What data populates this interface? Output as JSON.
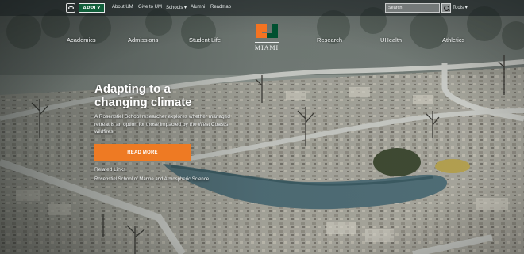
{
  "topbar": {
    "apply_label": "APPLY",
    "links": [
      "About UM",
      "Give to UM",
      "Schools",
      "Alumni",
      "Readmap"
    ],
    "schools_caret": "▾",
    "search_placeholder": "Search",
    "tools_label": "Tools",
    "tools_caret": "▾"
  },
  "nav": {
    "left": [
      "Academics",
      "Admissions",
      "Student Life"
    ],
    "right": [
      "Research",
      "UHealth",
      "Athletics"
    ],
    "logo_text": "MIAMI"
  },
  "hero": {
    "headline_line1": "Adapting to a",
    "headline_line2": "changing climate",
    "teaser": "A Rosenstiel School researcher explores whether managed retreat is an option for those impacted by the West Coast's wildfires.",
    "cta_label": "READ MORE",
    "related_title": "Related Links",
    "related_link": "Rosenstiel School of Marine and Atmospheric Science"
  },
  "colors": {
    "apply_bg": "#115e3a",
    "cta_bg": "#ee7a23",
    "logo_orange": "#f47321",
    "logo_green": "#005030"
  },
  "icons": [
    "eye-icon",
    "search-icon",
    "caret-down-icon",
    "u-logo-icon"
  ]
}
